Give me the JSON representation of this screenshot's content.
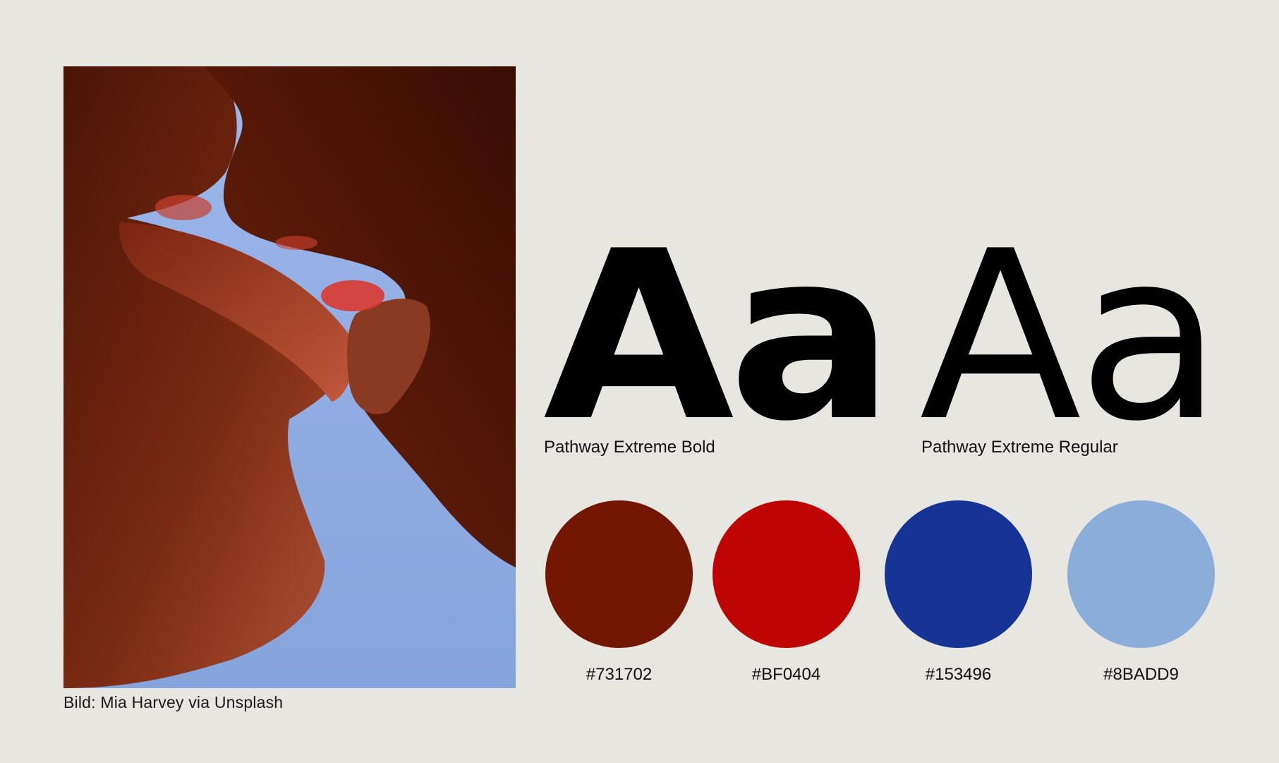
{
  "photo": {
    "caption": "Bild: Mia Harvey via Unsplash"
  },
  "typography": {
    "bold": {
      "specimen": "Aa",
      "label": "Pathway Extreme Bold"
    },
    "regular": {
      "specimen": "Aa",
      "label": "Pathway Extreme Regular"
    }
  },
  "palette": [
    {
      "label": "#731702",
      "color": "#731702"
    },
    {
      "label": "#BF0404",
      "color": "#BF0404"
    },
    {
      "label": "#153496",
      "color": "#153496"
    },
    {
      "label": "#8BADD9",
      "color": "#8BADD9"
    }
  ],
  "background_color": "#E7E6E1"
}
